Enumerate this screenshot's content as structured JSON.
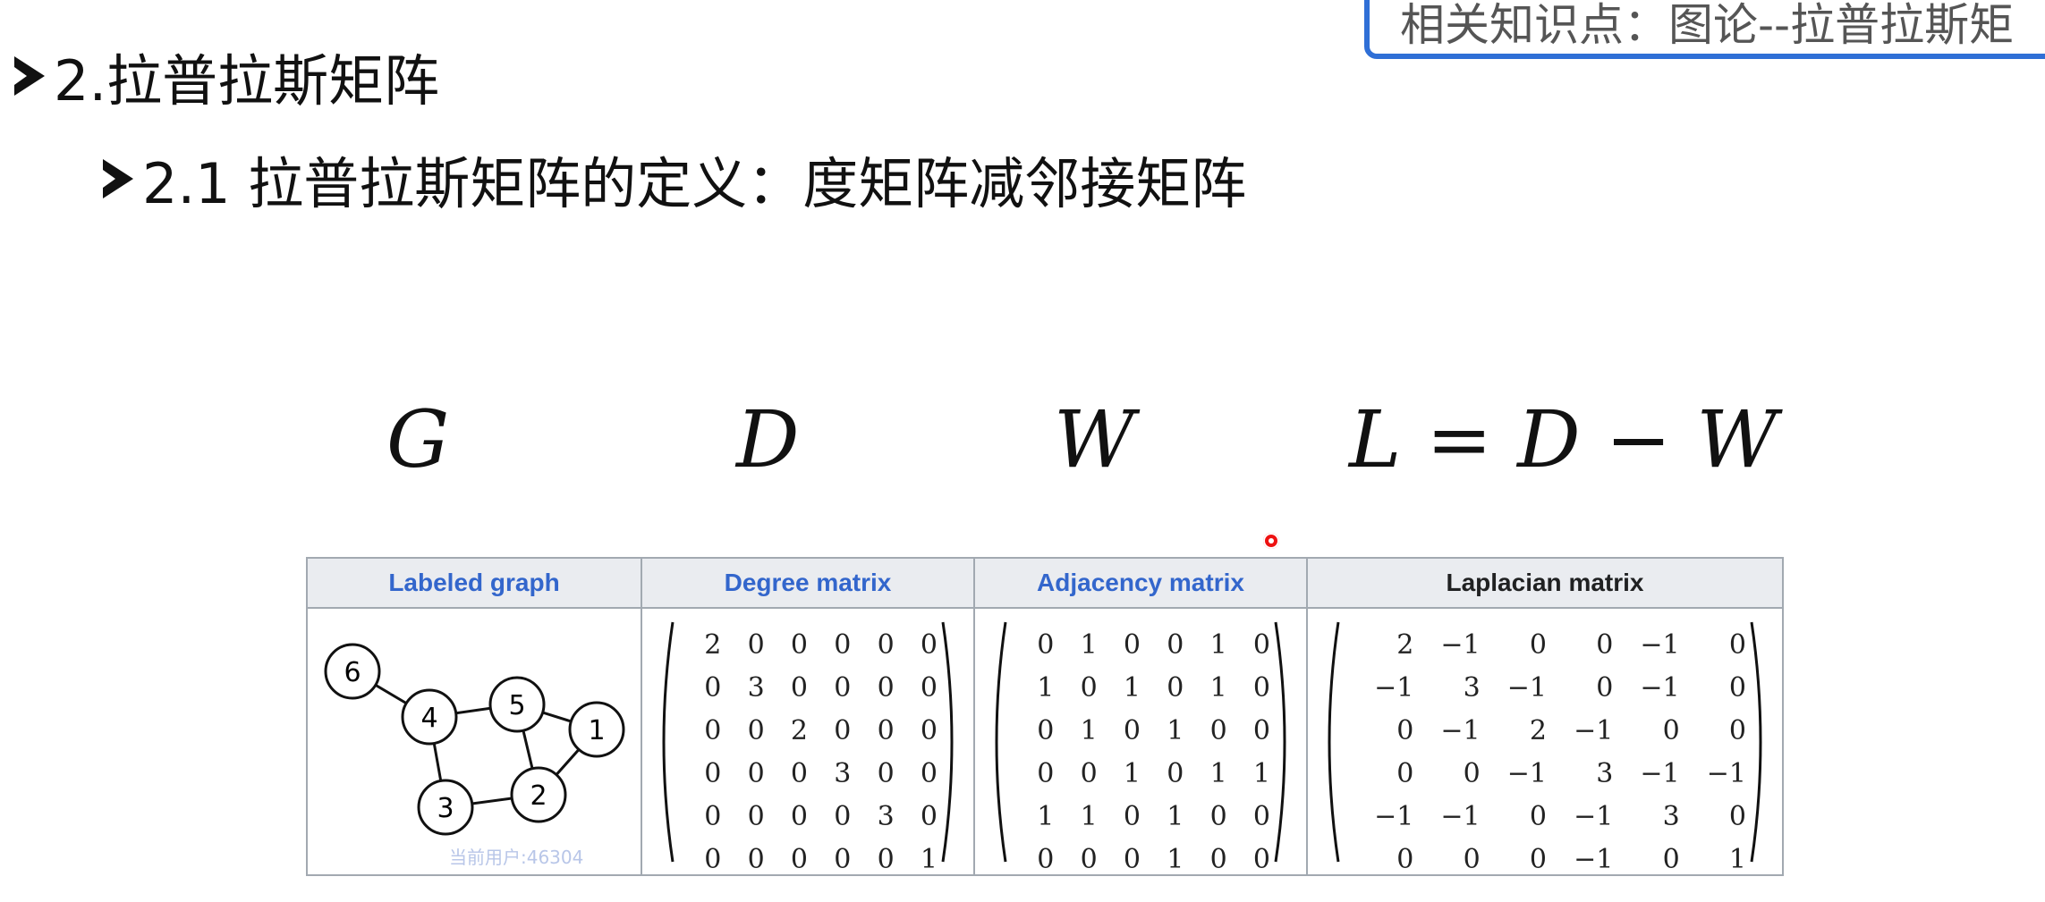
{
  "topic_box": {
    "text": "相关知识点：图论--拉普拉斯矩"
  },
  "bullets": {
    "level1": "2.拉普拉斯矩阵",
    "level2": "2.1 拉普拉斯矩阵的定义：度矩阵减邻接矩阵"
  },
  "formula": {
    "g": "G",
    "d": "D",
    "w": "W",
    "l": "L = D − W"
  },
  "table": {
    "headers": [
      "Labeled graph",
      "Degree matrix",
      "Adjacency matrix",
      "Laplacian matrix"
    ],
    "graph": {
      "nodes": [
        "6",
        "4",
        "5",
        "1",
        "3",
        "2"
      ],
      "edges": [
        [
          "6",
          "4"
        ],
        [
          "4",
          "5"
        ],
        [
          "4",
          "3"
        ],
        [
          "5",
          "1"
        ],
        [
          "5",
          "2"
        ],
        [
          "1",
          "2"
        ],
        [
          "3",
          "2"
        ]
      ]
    },
    "degree_matrix": [
      [
        "2",
        "0",
        "0",
        "0",
        "0",
        "0"
      ],
      [
        "0",
        "3",
        "0",
        "0",
        "0",
        "0"
      ],
      [
        "0",
        "0",
        "2",
        "0",
        "0",
        "0"
      ],
      [
        "0",
        "0",
        "0",
        "3",
        "0",
        "0"
      ],
      [
        "0",
        "0",
        "0",
        "0",
        "3",
        "0"
      ],
      [
        "0",
        "0",
        "0",
        "0",
        "0",
        "1"
      ]
    ],
    "adjacency_matrix": [
      [
        "0",
        "1",
        "0",
        "0",
        "1",
        "0"
      ],
      [
        "1",
        "0",
        "1",
        "0",
        "1",
        "0"
      ],
      [
        "0",
        "1",
        "0",
        "1",
        "0",
        "0"
      ],
      [
        "0",
        "0",
        "1",
        "0",
        "1",
        "1"
      ],
      [
        "1",
        "1",
        "0",
        "1",
        "0",
        "0"
      ],
      [
        "0",
        "0",
        "0",
        "1",
        "0",
        "0"
      ]
    ],
    "laplacian_matrix": [
      [
        "2",
        "−1",
        "0",
        "0",
        "−1",
        "0"
      ],
      [
        "−1",
        "3",
        "−1",
        "0",
        "−1",
        "0"
      ],
      [
        "0",
        "−1",
        "2",
        "−1",
        "0",
        "0"
      ],
      [
        "0",
        "0",
        "−1",
        "3",
        "−1",
        "−1"
      ],
      [
        "−1",
        "−1",
        "0",
        "−1",
        "3",
        "0"
      ],
      [
        "0",
        "0",
        "0",
        "−1",
        "0",
        "1"
      ]
    ]
  },
  "watermark": "当前用户:46304",
  "colors": {
    "topic_border": "#2f6fd6",
    "header_link": "#3366cc",
    "header_bg": "#eaecf0",
    "cursor": "#ee1111"
  }
}
